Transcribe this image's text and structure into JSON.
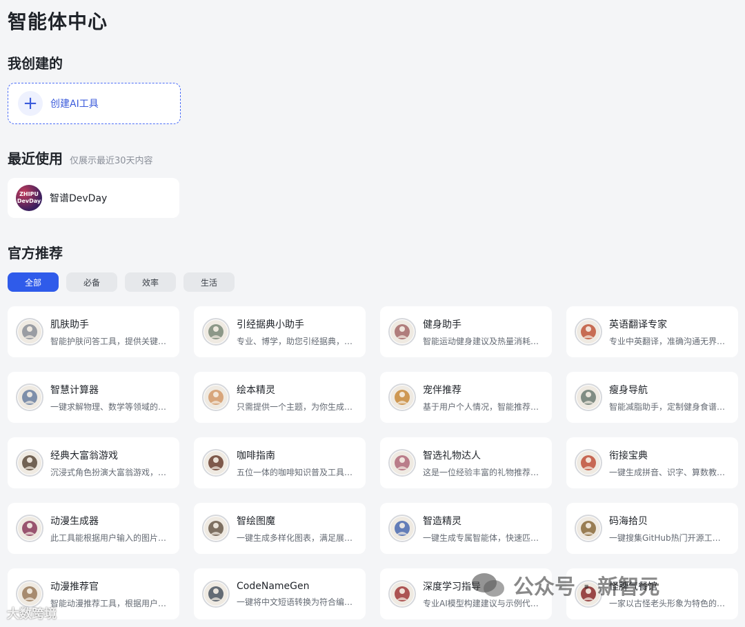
{
  "page_title": "智能体中心",
  "mine": {
    "title": "我创建的",
    "create_label": "创建AI工具"
  },
  "recent": {
    "title": "最近使用",
    "subtitle": "仅展示最近30天内容",
    "items": [
      {
        "name": "智谱DevDay",
        "avatar_line1": "ZHIPU",
        "avatar_line2": "DevDay"
      }
    ]
  },
  "official": {
    "title": "官方推荐",
    "tabs": [
      {
        "label": "全部",
        "active": true
      },
      {
        "label": "必备",
        "active": false
      },
      {
        "label": "效率",
        "active": false
      },
      {
        "label": "生活",
        "active": false
      }
    ],
    "items": [
      {
        "name": "肌肤助手",
        "desc": "智能护肤问答工具，提供关键…",
        "icon": "skin-avatar",
        "color": "#8b8f98"
      },
      {
        "name": "引经据典小助手",
        "desc": "专业、博学，助您引经据典，…",
        "icon": "mountain-avatar",
        "color": "#7a8a78"
      },
      {
        "name": "健身助手",
        "desc": "智能运动健身建议及热量消耗…",
        "icon": "fitness-avatar",
        "color": "#a46a6a"
      },
      {
        "name": "英语翻译专家",
        "desc": "专业中英翻译，准确沟通无界…",
        "icon": "translate-avatar",
        "color": "#c0563a"
      },
      {
        "name": "智慧计算器",
        "desc": "一键求解物理、数学等领域的…",
        "icon": "calculator-avatar",
        "color": "#6a7fa0"
      },
      {
        "name": "绘本精灵",
        "desc": "只需提供一个主题，为你生成…",
        "icon": "picturebook-avatar",
        "color": "#d49a6a"
      },
      {
        "name": "宠伴推荐",
        "desc": "基于用户个人情况，智能推荐…",
        "icon": "pet-avatar",
        "color": "#c88a3a"
      },
      {
        "name": "瘦身导航",
        "desc": "智能减脂助手，定制健身食谱…",
        "icon": "slim-avatar",
        "color": "#6d7d73"
      },
      {
        "name": "经典大富翁游戏",
        "desc": "沉浸式角色扮演大富翁游戏，…",
        "icon": "monopoly-avatar",
        "color": "#5a4a3a"
      },
      {
        "name": "咖啡指南",
        "desc": "五位一体的咖啡知识普及工具…",
        "icon": "coffee-avatar",
        "color": "#6a4030"
      },
      {
        "name": "智选礼物达人",
        "desc": "这是一位经验丰富的礼物推荐…",
        "icon": "gift-avatar",
        "color": "#b06a7a"
      },
      {
        "name": "衔接宝典",
        "desc": "一键生成拼音、识字、算数教…",
        "icon": "textbook-avatar",
        "color": "#c0503a"
      },
      {
        "name": "动漫生成器",
        "desc": "此工具能根据用户输入的图片…",
        "icon": "anime-gen-avatar",
        "color": "#8a3a5a"
      },
      {
        "name": "智绘图魔",
        "desc": "一键生成多样化图表，满足展…",
        "icon": "chart-wizard-avatar",
        "color": "#6a5a4a"
      },
      {
        "name": "智造精灵",
        "desc": "一键生成专属智能体，快速匹…",
        "icon": "agent-builder-avatar",
        "color": "#4a6ab0"
      },
      {
        "name": "码海拾贝",
        "desc": "一键搜集GitHub热门开源工…",
        "icon": "github-avatar",
        "color": "#8a6a3a"
      },
      {
        "name": "动漫推荐官",
        "desc": "智能动漫推荐工具，根据用户…",
        "icon": "anime-rec-avatar",
        "color": "#9a7a5a"
      },
      {
        "name": "CodeNameGen",
        "desc": "一键将中文短语转换为符合编…",
        "icon": "codename-avatar",
        "color": "#4a5560"
      },
      {
        "name": "深度学习指导",
        "desc": "专业AI模型构建建议与示例代…",
        "icon": "deep-learning-avatar",
        "color": "#a03a3a"
      },
      {
        "name": "怪脾气餐馆",
        "desc": "一家以古怪老头形象为特色的…",
        "icon": "restaurant-avatar",
        "color": "#8a2a2a"
      }
    ]
  },
  "watermarks": {
    "wechat": "公众号 · 新智元",
    "bottom": "大数跨境"
  }
}
